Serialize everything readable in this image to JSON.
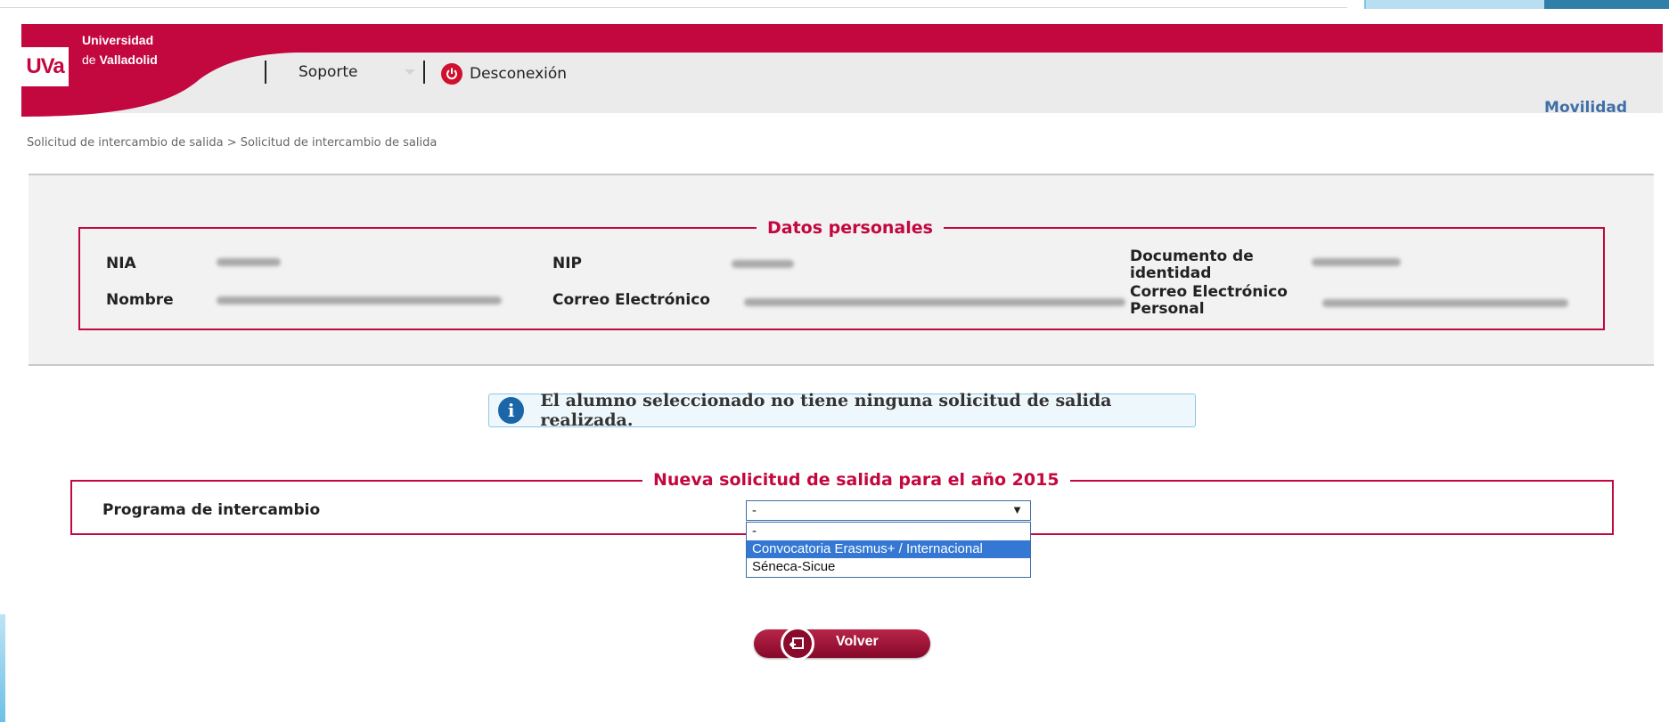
{
  "brand": {
    "logo_text": "UVa",
    "name_line1": "Universidad",
    "name_line2_prefix": "de ",
    "name_line2_bold": "Valladolid",
    "primary_color": "#c3073f",
    "link_color": "#3f6fa8"
  },
  "nav": {
    "support_label": "Soporte",
    "logout_label": "Desconexión",
    "logout_icon": "power-icon",
    "section_link": "Movilidad"
  },
  "breadcrumb": "Solicitud de intercambio de salida > Solicitud de intercambio de salida",
  "personal": {
    "legend": "Datos personales",
    "fields": {
      "nia_label": "NIA",
      "nip_label": "NIP",
      "doc_label": "Documento de identidad",
      "name_label": "Nombre",
      "email_label": "Correo Electrónico",
      "personal_email_label": "Correo Electrónico Personal"
    }
  },
  "info": {
    "icon": "info-icon",
    "message": "El alumno seleccionado no tiene ninguna solicitud de salida realizada."
  },
  "new_request": {
    "legend": "Nueva solicitud de salida para el año 2015",
    "program_label": "Programa de intercambio",
    "selected_value": "-",
    "options": [
      "-",
      "Convocatoria Erasmus+ / Internacional",
      "Séneca-Sicue"
    ],
    "highlighted_option": "Convocatoria Erasmus+ / Internacional"
  },
  "actions": {
    "back_label": "Volver",
    "back_icon": "return-icon"
  }
}
